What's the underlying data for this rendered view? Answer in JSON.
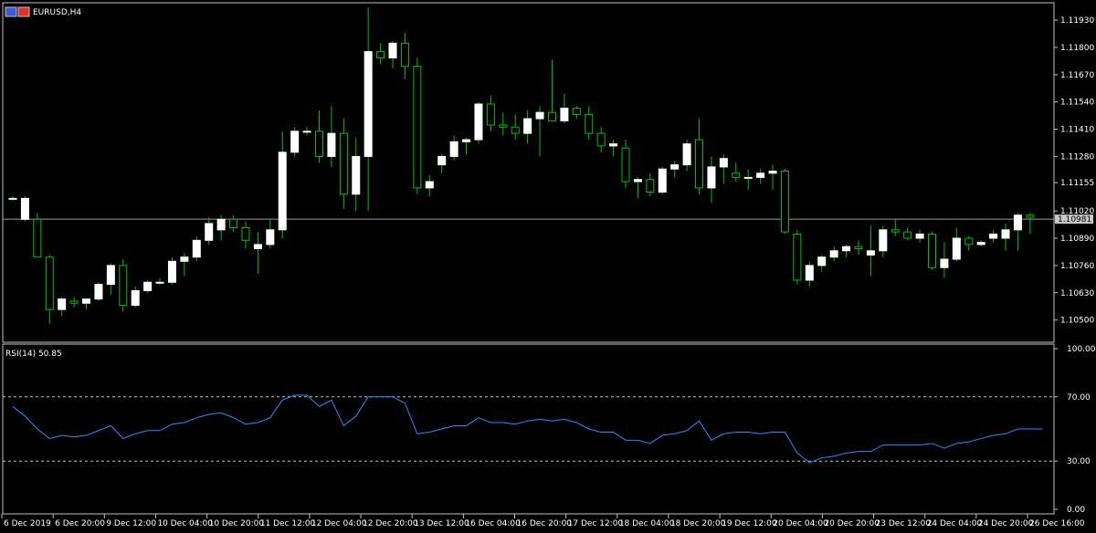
{
  "header": {
    "symbol": "EURUSD,H4",
    "icon": "chart-window-icon"
  },
  "indicator": {
    "label": "RSI(14) 50.85",
    "levels": [
      30,
      70
    ]
  },
  "colors": {
    "background": "#000000",
    "bull_body": "#ffffff",
    "bear_body": "#000000",
    "wick": "#00c000",
    "rsi_line": "#1e90ff",
    "frame": "#c0c0c0",
    "level_line": "#c0c0c0"
  },
  "chart_data": [
    {
      "type": "candlestick",
      "title": "EURUSD,H4",
      "ylim": [
        1.1042,
        1.12
      ],
      "ytick_labels": [
        "1.11930",
        "1.11800",
        "1.11670",
        "1.11540",
        "1.11410",
        "1.11280",
        "1.11155",
        "1.11020",
        "1.10890",
        "1.10760",
        "1.10630",
        "1.10500"
      ],
      "current_price": "1.10981",
      "xtick_labels": [
        "6 Dec 2019",
        "6 Dec 20:00",
        "9 Dec 12:00",
        "10 Dec 04:00",
        "10 Dec 20:00",
        "11 Dec 12:00",
        "12 Dec 04:00",
        "12 Dec 20:00",
        "13 Dec 12:00",
        "16 Dec 04:00",
        "16 Dec 20:00",
        "17 Dec 12:00",
        "18 Dec 04:00",
        "18 Dec 20:00",
        "19 Dec 12:00",
        "20 Dec 04:00",
        "20 Dec 20:00",
        "23 Dec 12:00",
        "24 Dec 04:00",
        "24 Dec 20:00",
        "26 Dec 16:00"
      ],
      "candles": [
        {
          "o": 1.1108,
          "h": 1.1109,
          "l": 1.1107,
          "c": 1.1108
        },
        {
          "o": 1.1098,
          "h": 1.1109,
          "l": 1.1097,
          "c": 1.1108
        },
        {
          "o": 1.1098,
          "h": 1.1101,
          "l": 1.1081,
          "c": 1.108
        },
        {
          "o": 1.108,
          "h": 1.1081,
          "l": 1.1048,
          "c": 1.1055
        },
        {
          "o": 1.1055,
          "h": 1.1061,
          "l": 1.1052,
          "c": 1.106
        },
        {
          "o": 1.1059,
          "h": 1.1061,
          "l": 1.1056,
          "c": 1.1058
        },
        {
          "o": 1.1058,
          "h": 1.106,
          "l": 1.1055,
          "c": 1.106
        },
        {
          "o": 1.106,
          "h": 1.1068,
          "l": 1.1059,
          "c": 1.1067
        },
        {
          "o": 1.1067,
          "h": 1.1077,
          "l": 1.1062,
          "c": 1.1076
        },
        {
          "o": 1.1076,
          "h": 1.1079,
          "l": 1.1054,
          "c": 1.1057
        },
        {
          "o": 1.1057,
          "h": 1.1066,
          "l": 1.1056,
          "c": 1.1064
        },
        {
          "o": 1.1064,
          "h": 1.1069,
          "l": 1.1063,
          "c": 1.1068
        },
        {
          "o": 1.1068,
          "h": 1.107,
          "l": 1.1067,
          "c": 1.1068
        },
        {
          "o": 1.1068,
          "h": 1.108,
          "l": 1.1067,
          "c": 1.1078
        },
        {
          "o": 1.1078,
          "h": 1.1082,
          "l": 1.1071,
          "c": 1.108
        },
        {
          "o": 1.108,
          "h": 1.109,
          "l": 1.1078,
          "c": 1.1088
        },
        {
          "o": 1.1088,
          "h": 1.1099,
          "l": 1.1086,
          "c": 1.1096
        },
        {
          "o": 1.1093,
          "h": 1.11,
          "l": 1.1088,
          "c": 1.1098
        },
        {
          "o": 1.1098,
          "h": 1.11,
          "l": 1.1092,
          "c": 1.1094
        },
        {
          "o": 1.1094,
          "h": 1.1097,
          "l": 1.1084,
          "c": 1.1088
        },
        {
          "o": 1.1084,
          "h": 1.1092,
          "l": 1.1072,
          "c": 1.1086
        },
        {
          "o": 1.1086,
          "h": 1.1098,
          "l": 1.1084,
          "c": 1.1093
        },
        {
          "o": 1.1093,
          "h": 1.114,
          "l": 1.1089,
          "c": 1.113
        },
        {
          "o": 1.113,
          "h": 1.1142,
          "l": 1.1128,
          "c": 1.114
        },
        {
          "o": 1.114,
          "h": 1.1142,
          "l": 1.1138,
          "c": 1.114
        },
        {
          "o": 1.114,
          "h": 1.115,
          "l": 1.1125,
          "c": 1.1128
        },
        {
          "o": 1.1128,
          "h": 1.1152,
          "l": 1.1123,
          "c": 1.1139
        },
        {
          "o": 1.1139,
          "h": 1.1146,
          "l": 1.1103,
          "c": 1.111
        },
        {
          "o": 1.111,
          "h": 1.1137,
          "l": 1.1102,
          "c": 1.1128
        },
        {
          "o": 1.1128,
          "h": 1.1199,
          "l": 1.1102,
          "c": 1.1178
        },
        {
          "o": 1.1178,
          "h": 1.1182,
          "l": 1.1172,
          "c": 1.1175
        },
        {
          "o": 1.1175,
          "h": 1.1183,
          "l": 1.117,
          "c": 1.1182
        },
        {
          "o": 1.1182,
          "h": 1.1187,
          "l": 1.1165,
          "c": 1.1171
        },
        {
          "o": 1.1171,
          "h": 1.1175,
          "l": 1.111,
          "c": 1.1113
        },
        {
          "o": 1.1113,
          "h": 1.1119,
          "l": 1.1109,
          "c": 1.1116
        },
        {
          "o": 1.1124,
          "h": 1.1129,
          "l": 1.112,
          "c": 1.1128
        },
        {
          "o": 1.1128,
          "h": 1.1138,
          "l": 1.1126,
          "c": 1.1135
        },
        {
          "o": 1.1135,
          "h": 1.1137,
          "l": 1.1129,
          "c": 1.1136
        },
        {
          "o": 1.1136,
          "h": 1.1154,
          "l": 1.1134,
          "c": 1.1153
        },
        {
          "o": 1.1153,
          "h": 1.1157,
          "l": 1.114,
          "c": 1.1143
        },
        {
          "o": 1.1143,
          "h": 1.1149,
          "l": 1.1138,
          "c": 1.1142
        },
        {
          "o": 1.1142,
          "h": 1.1148,
          "l": 1.1136,
          "c": 1.1139
        },
        {
          "o": 1.1139,
          "h": 1.115,
          "l": 1.1134,
          "c": 1.1146
        },
        {
          "o": 1.1146,
          "h": 1.1152,
          "l": 1.1128,
          "c": 1.1149
        },
        {
          "o": 1.1149,
          "h": 1.1174,
          "l": 1.1145,
          "c": 1.1145
        },
        {
          "o": 1.1145,
          "h": 1.1158,
          "l": 1.1144,
          "c": 1.1151
        },
        {
          "o": 1.1151,
          "h": 1.1152,
          "l": 1.1146,
          "c": 1.1148
        },
        {
          "o": 1.1148,
          "h": 1.1152,
          "l": 1.1136,
          "c": 1.1139
        },
        {
          "o": 1.1139,
          "h": 1.1142,
          "l": 1.113,
          "c": 1.1133
        },
        {
          "o": 1.1133,
          "h": 1.1136,
          "l": 1.1128,
          "c": 1.1134
        },
        {
          "o": 1.1132,
          "h": 1.1136,
          "l": 1.1113,
          "c": 1.1116
        },
        {
          "o": 1.1116,
          "h": 1.1118,
          "l": 1.1108,
          "c": 1.1117
        },
        {
          "o": 1.1117,
          "h": 1.112,
          "l": 1.1109,
          "c": 1.1111
        },
        {
          "o": 1.1111,
          "h": 1.1123,
          "l": 1.111,
          "c": 1.1122
        },
        {
          "o": 1.1122,
          "h": 1.1126,
          "l": 1.1118,
          "c": 1.1124
        },
        {
          "o": 1.1124,
          "h": 1.1136,
          "l": 1.1121,
          "c": 1.1134
        },
        {
          "o": 1.1136,
          "h": 1.1146,
          "l": 1.111,
          "c": 1.1113
        },
        {
          "o": 1.1113,
          "h": 1.1128,
          "l": 1.1106,
          "c": 1.1123
        },
        {
          "o": 1.1123,
          "h": 1.1129,
          "l": 1.1115,
          "c": 1.1127
        },
        {
          "o": 1.112,
          "h": 1.1125,
          "l": 1.1116,
          "c": 1.1118
        },
        {
          "o": 1.1118,
          "h": 1.1122,
          "l": 1.1112,
          "c": 1.1118
        },
        {
          "o": 1.1118,
          "h": 1.1122,
          "l": 1.1115,
          "c": 1.112
        },
        {
          "o": 1.112,
          "h": 1.1124,
          "l": 1.1112,
          "c": 1.1121
        },
        {
          "o": 1.1121,
          "h": 1.1122,
          "l": 1.1091,
          "c": 1.1092
        },
        {
          "o": 1.1091,
          "h": 1.1093,
          "l": 1.1067,
          "c": 1.1069
        },
        {
          "o": 1.1069,
          "h": 1.1078,
          "l": 1.1066,
          "c": 1.1076
        },
        {
          "o": 1.1076,
          "h": 1.1081,
          "l": 1.1073,
          "c": 1.108
        },
        {
          "o": 1.108,
          "h": 1.1085,
          "l": 1.1078,
          "c": 1.1083
        },
        {
          "o": 1.1083,
          "h": 1.1086,
          "l": 1.108,
          "c": 1.1085
        },
        {
          "o": 1.1085,
          "h": 1.1088,
          "l": 1.1081,
          "c": 1.1084
        },
        {
          "o": 1.1081,
          "h": 1.1095,
          "l": 1.1071,
          "c": 1.1083
        },
        {
          "o": 1.1083,
          "h": 1.1095,
          "l": 1.108,
          "c": 1.1093
        },
        {
          "o": 1.1093,
          "h": 1.1098,
          "l": 1.109,
          "c": 1.1092
        },
        {
          "o": 1.1092,
          "h": 1.1094,
          "l": 1.1088,
          "c": 1.1089
        },
        {
          "o": 1.1089,
          "h": 1.1093,
          "l": 1.1087,
          "c": 1.1091
        },
        {
          "o": 1.1091,
          "h": 1.1092,
          "l": 1.1074,
          "c": 1.1075
        },
        {
          "o": 1.1075,
          "h": 1.1087,
          "l": 1.107,
          "c": 1.1079
        },
        {
          "o": 1.1079,
          "h": 1.1094,
          "l": 1.1078,
          "c": 1.1089
        },
        {
          "o": 1.1089,
          "h": 1.109,
          "l": 1.1083,
          "c": 1.1086
        },
        {
          "o": 1.1086,
          "h": 1.1088,
          "l": 1.1085,
          "c": 1.1087
        },
        {
          "o": 1.1089,
          "h": 1.1093,
          "l": 1.1087,
          "c": 1.1091
        },
        {
          "o": 1.1089,
          "h": 1.1096,
          "l": 1.1083,
          "c": 1.1093
        },
        {
          "o": 1.1093,
          "h": 1.1101,
          "l": 1.1083,
          "c": 1.11
        },
        {
          "o": 1.11,
          "h": 1.1101,
          "l": 1.1091,
          "c": 1.1099
        }
      ]
    },
    {
      "type": "line",
      "title": "RSI(14) 50.85",
      "ylim": [
        0,
        100
      ],
      "ytick_labels": [
        "100.00",
        "70.00",
        "30.00",
        "0.00"
      ],
      "levels": [
        30,
        70
      ],
      "series": [
        {
          "values": [
            64,
            58,
            50,
            44,
            46,
            45,
            46,
            49,
            52,
            44,
            47,
            49,
            49,
            53,
            54,
            57,
            59,
            60,
            57,
            53,
            54,
            57,
            68,
            71,
            71,
            64,
            68,
            52,
            58,
            70,
            70,
            70,
            66,
            47,
            48,
            50,
            52,
            52,
            57,
            54,
            54,
            53,
            55,
            56,
            55,
            56,
            54,
            50,
            48,
            48,
            43,
            43,
            41,
            46,
            47,
            49,
            55,
            43,
            47,
            48,
            48,
            47,
            48,
            48,
            35,
            29,
            32,
            33,
            35,
            36,
            36,
            40,
            40,
            40,
            40,
            41,
            38,
            41,
            42,
            44,
            46,
            47,
            50,
            50,
            50
          ]
        }
      ]
    }
  ]
}
